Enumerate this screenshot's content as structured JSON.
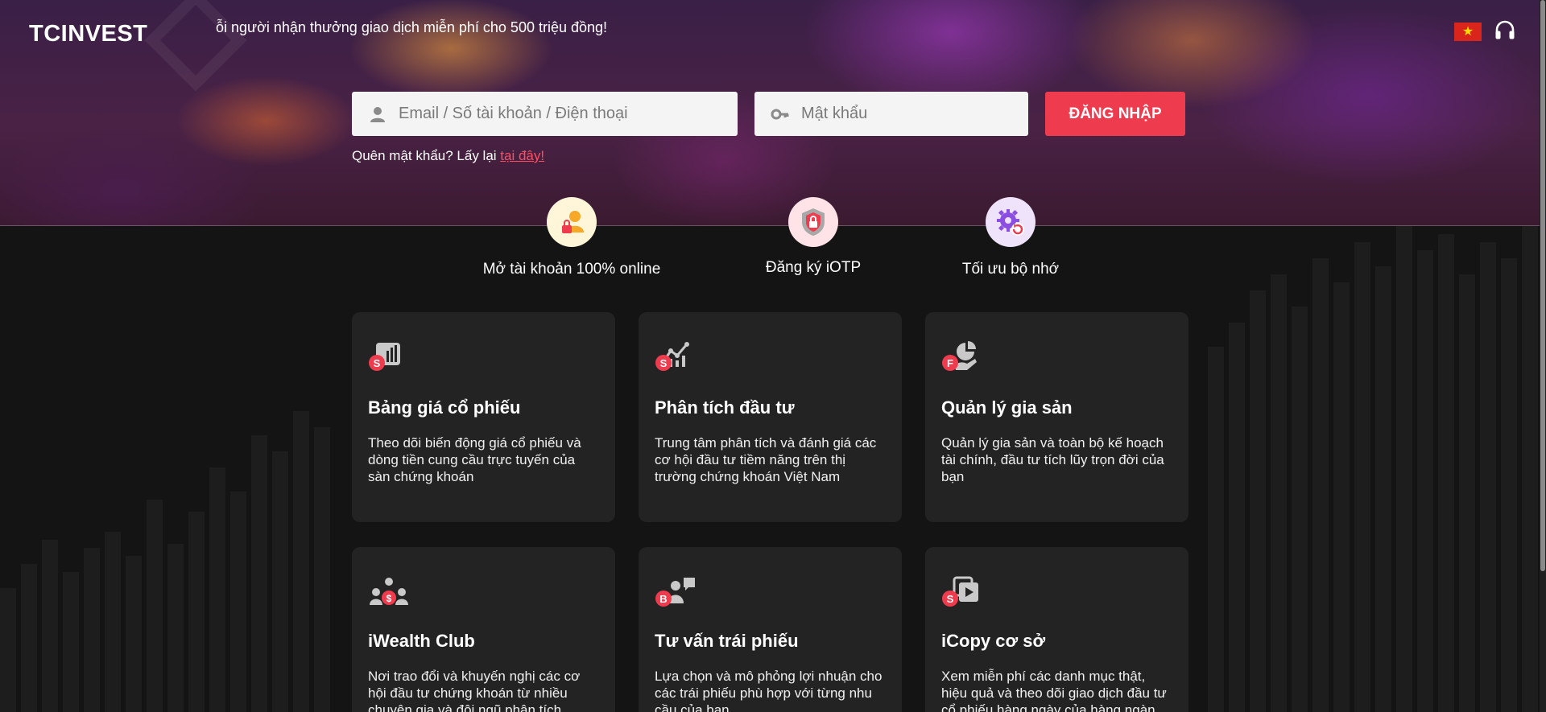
{
  "brand": {
    "logo_text": "TCINVEST"
  },
  "announcement": "ỗi người nhận thưởng giao dịch miễn phí cho 500 triệu đồng!",
  "header_icons": [
    "vietnam-flag-icon",
    "headset-icon"
  ],
  "login": {
    "username_placeholder": "Email / Số tài khoản / Điện thoại",
    "password_placeholder": "Mật khẩu",
    "submit_label": "ĐĂNG NHẬP",
    "forgot_text": "Quên mật khẩu? Lấy lại ",
    "forgot_link": "tại đây!"
  },
  "quick_actions": [
    {
      "label": "Mở tài khoản 100% online",
      "icon": "user-lock-icon"
    },
    {
      "label": "Đăng ký iOTP",
      "icon": "shield-lock-icon"
    },
    {
      "label": "Tối ưu bộ nhớ",
      "icon": "gear-refresh-icon"
    }
  ],
  "cards": [
    {
      "title": "Bảng giá cổ phiếu",
      "description": "Theo dõi biến động giá cổ phiếu và dòng tiền cung cầu trực tuyến của sàn chứng khoán",
      "icon": "price-board-icon",
      "badge": "S"
    },
    {
      "title": "Phân tích đầu tư",
      "description": "Trung tâm phân tích và đánh giá các cơ hội đầu tư tiềm năng trên thị trường chứng khoán Việt Nam",
      "icon": "analysis-chart-icon",
      "badge": "S"
    },
    {
      "title": "Quản lý gia sản",
      "description": "Quản lý gia sản và toàn bộ kế hoạch tài chính, đầu tư tích lũy trọn đời của bạn",
      "icon": "wealth-pie-icon",
      "badge": "F"
    },
    {
      "title": "iWealth Club",
      "description": "Nơi trao đổi và khuyến nghị các cơ hội đầu tư chứng khoán từ nhiều chuyên gia và đội ngũ phân tích",
      "icon": "community-group-icon",
      "badge": "$"
    },
    {
      "title": "Tư vấn trái phiếu",
      "description": "Lựa chọn và mô phỏng lợi nhuận cho các trái phiếu phù hợp với từng nhu cầu của bạn",
      "icon": "bond-advisor-icon",
      "badge": "B"
    },
    {
      "title": "iCopy cơ sở",
      "description": "Xem miễn phí các danh mục thật, hiệu quả và theo dõi giao dịch đầu tư cổ phiếu hàng ngày của hàng ngàn",
      "icon": "copy-play-icon",
      "badge": "S"
    }
  ],
  "colors": {
    "accent": "#ef3b4e",
    "card_bg": "#232323",
    "page_bg": "#141414"
  }
}
